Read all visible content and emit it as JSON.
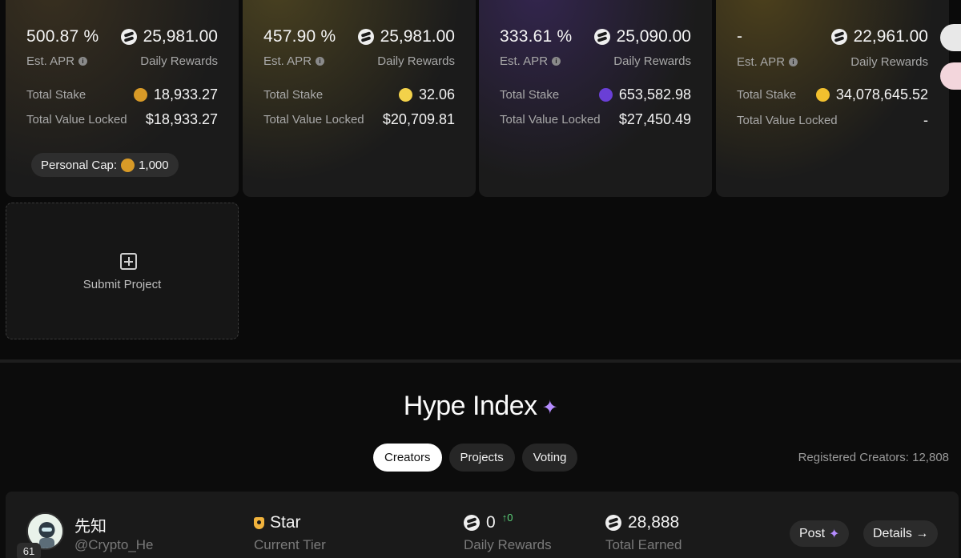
{
  "cards": [
    {
      "apr": "500.87 %",
      "rewards": "25,981.00",
      "apr_label": "Est. APR",
      "rewards_label": "Daily Rewards",
      "stake_label": "Total Stake",
      "stake": "18,933.27",
      "tvl_label": "Total Value Locked",
      "tvl": "$18,933.27",
      "cap_label": "Personal Cap:",
      "cap_value": "1,000",
      "coin_color": "#d89a27"
    },
    {
      "apr": "457.90 %",
      "rewards": "25,981.00",
      "apr_label": "Est. APR",
      "rewards_label": "Daily Rewards",
      "stake_label": "Total Stake",
      "stake": "32.06",
      "tvl_label": "Total Value Locked",
      "tvl": "$20,709.81",
      "coin_color": "#f3d24a"
    },
    {
      "apr": "333.61 %",
      "rewards": "25,090.00",
      "apr_label": "Est. APR",
      "rewards_label": "Daily Rewards",
      "stake_label": "Total Stake",
      "stake": "653,582.98",
      "tvl_label": "Total Value Locked",
      "tvl": "$27,450.49",
      "coin_color": "#6a3fd6"
    },
    {
      "apr": "-",
      "rewards": "22,961.00",
      "apr_label": "Est. APR",
      "rewards_label": "Daily Rewards",
      "stake_label": "Total Stake",
      "stake": "34,078,645.52",
      "tvl_label": "Total Value Locked",
      "tvl": "-",
      "coin_color": "#f2c02e"
    }
  ],
  "submit": {
    "label": "Submit Project"
  },
  "hype": {
    "title": "Hype Index",
    "tabs": [
      "Creators",
      "Projects",
      "Voting"
    ],
    "registered": "Registered Creators: 12,808"
  },
  "creator": {
    "rank": "61",
    "name": "先知",
    "handle": "@Crypto_He",
    "tier": "Star",
    "tier_label": "Current Tier",
    "daily": "0",
    "daily_change": "↑0",
    "daily_label": "Daily Rewards",
    "earned": "28,888",
    "earned_label": "Total Earned",
    "post_label": "Post",
    "details_label": "Details →"
  },
  "colors": {
    "accent_purple": "#b58cff",
    "up_green": "#5cd37a"
  }
}
